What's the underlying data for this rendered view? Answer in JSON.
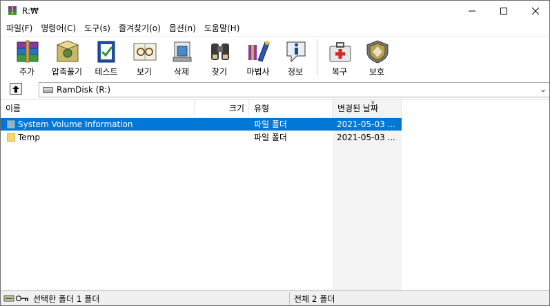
{
  "window": {
    "title": "R:₩"
  },
  "menu": [
    "파일(F)",
    "명령어(C)",
    "도구(s)",
    "즐겨찾기(o)",
    "옵션(n)",
    "도움말(H)"
  ],
  "toolbar": [
    {
      "label": "추가",
      "icon": "add-books-icon"
    },
    {
      "label": "압축풀기",
      "icon": "extract-icon"
    },
    {
      "label": "테스트",
      "icon": "test-icon"
    },
    {
      "label": "보기",
      "icon": "view-glasses-icon"
    },
    {
      "label": "삭제",
      "icon": "delete-icon"
    },
    {
      "label": "찾기",
      "icon": "find-binoculars-icon"
    },
    {
      "label": "마법사",
      "icon": "wizard-icon"
    },
    {
      "label": "정보",
      "icon": "info-icon"
    },
    {
      "label": "복구",
      "icon": "repair-kit-icon"
    },
    {
      "label": "보호",
      "icon": "protect-shield-icon"
    }
  ],
  "address": {
    "path": "RamDisk (R:)"
  },
  "columns": {
    "name": "이름",
    "size": "크기",
    "type": "유형",
    "modified": "변경된 날짜"
  },
  "files": [
    {
      "name": "System Volume Information",
      "size": "",
      "type": "파일 폴더",
      "modified": "2021-05-03 ...",
      "selected": true
    },
    {
      "name": "Temp",
      "size": "",
      "type": "파일 폴더",
      "modified": "2021-05-03 ...",
      "selected": false
    }
  ],
  "status": {
    "left": "선택한 폴더 1 폴더",
    "right": "전체 2 폴더"
  },
  "colors": {
    "selection": "#0078d7",
    "folder": "#f6d66e"
  }
}
